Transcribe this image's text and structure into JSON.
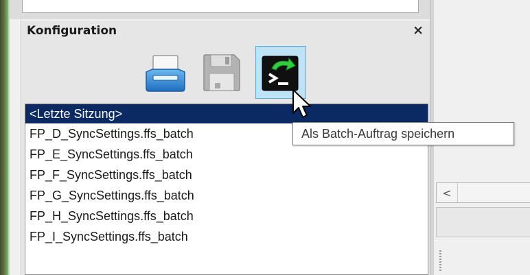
{
  "panel": {
    "title": "Konfiguration",
    "close_label": "×"
  },
  "toolbar": {
    "buttons": [
      {
        "name": "open-config",
        "icon": "printer-tray-icon"
      },
      {
        "name": "save-config",
        "icon": "floppy-disk-icon",
        "state": "disabled"
      },
      {
        "name": "save-as-batch",
        "icon": "terminal-batch-icon",
        "state": "hovered"
      }
    ]
  },
  "tooltip": {
    "text": "Als Batch-Auftrag speichern"
  },
  "config_list": {
    "items": [
      "<Letzte Sitzung>",
      "FP_D_SyncSettings.ffs_batch",
      "FP_E_SyncSettings.ffs_batch",
      "FP_F_SyncSettings.ffs_batch",
      "FP_G_SyncSettings.ffs_batch",
      "FP_H_SyncSettings.ffs_batch",
      "FP_I_SyncSettings.ffs_batch"
    ],
    "selected_index": 0
  },
  "right_pane": {
    "scroll_left_label": "<"
  },
  "colors": {
    "selection_bg": "#0b2a63",
    "hover_button_bg": "#bfe3f6",
    "panel_bg": "#e6e6e6"
  }
}
